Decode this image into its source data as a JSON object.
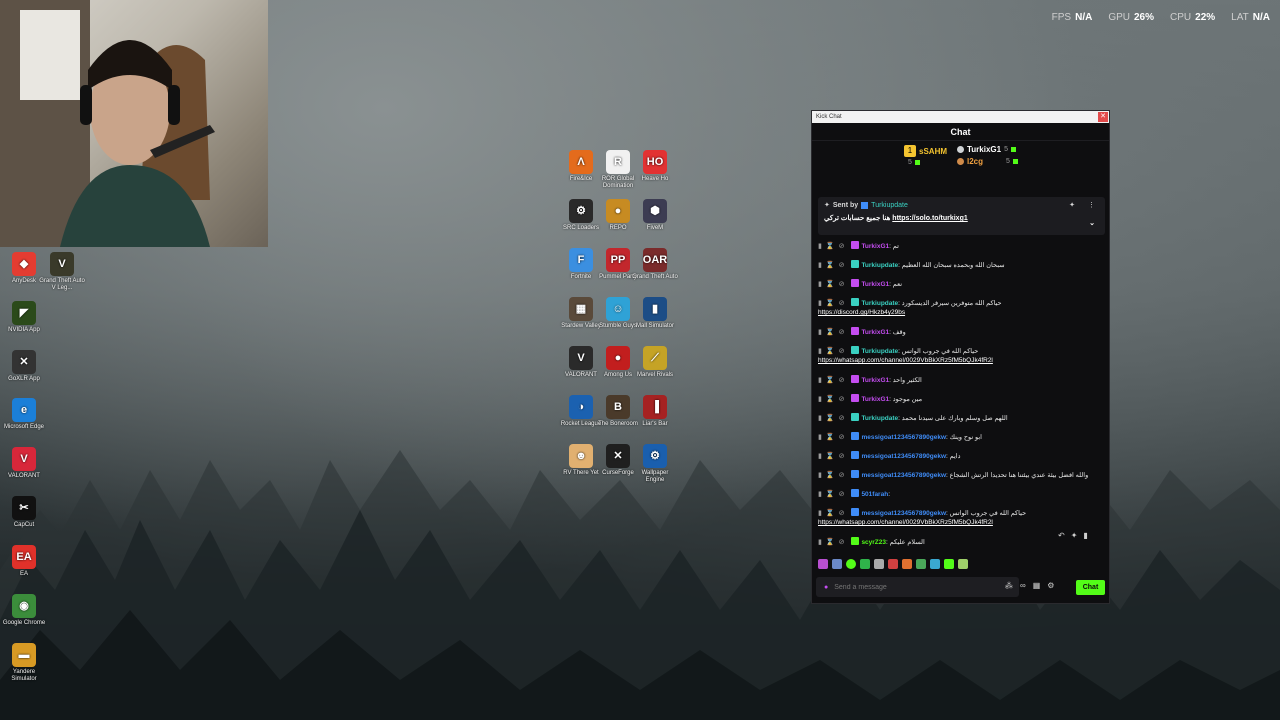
{
  "hud": {
    "fps_label": "FPS",
    "fps_value": "N/A",
    "gpu_label": "GPU",
    "gpu_value": "26%",
    "cpu_label": "CPU",
    "cpu_value": "22%",
    "lat_label": "LAT",
    "lat_value": "N/A"
  },
  "left_icons": [
    {
      "name": "AnyDesk",
      "color": "#e43c31",
      "glyph": "◆"
    },
    {
      "name": "Grand Theft Auto V Leg...",
      "color": "#3a3a2a",
      "glyph": "V"
    },
    {
      "name": "NVIDIA App",
      "color": "#2b4a1a",
      "glyph": "◤"
    },
    {
      "name": "GoXLR App",
      "color": "#333333",
      "glyph": "✕"
    },
    {
      "name": "Microsoft Edge",
      "color": "#1b7fd8",
      "glyph": "e"
    },
    {
      "name": "VALORANT",
      "color": "#d8273a",
      "glyph": "V"
    },
    {
      "name": "CapCut",
      "color": "#111111",
      "glyph": "✂"
    },
    {
      "name": "EA",
      "color": "#e0312a",
      "glyph": "EA"
    },
    {
      "name": "Google Chrome",
      "color": "#3b8d3b",
      "glyph": "◉"
    },
    {
      "name": "Yandere Simulator",
      "color": "#d89a24",
      "glyph": "▬"
    }
  ],
  "grid_icons": [
    {
      "name": "Fire&Ice",
      "color": "#e46b1c",
      "glyph": "Λ"
    },
    {
      "name": "ROR Global Domination",
      "color": "#f1f1f1",
      "glyph": "R"
    },
    {
      "name": "Heave Ho",
      "color": "#e23232",
      "glyph": "HO"
    },
    {
      "name": "SRC Loaders",
      "color": "#2a2a2a",
      "glyph": "⚙"
    },
    {
      "name": "REPO",
      "color": "#c78b22",
      "glyph": "●"
    },
    {
      "name": "FiveM",
      "color": "#3c3c52",
      "glyph": "⬢"
    },
    {
      "name": "Fortnite",
      "color": "#3b8fe0",
      "glyph": "F"
    },
    {
      "name": "Pummel Party",
      "color": "#c2272d",
      "glyph": "PP"
    },
    {
      "name": "Grand Theft Auto",
      "color": "#7a2b2b",
      "glyph": "OAR"
    },
    {
      "name": "Stardew Valley",
      "color": "#5a4a3a",
      "glyph": "▦"
    },
    {
      "name": "Stumble Guys",
      "color": "#2fa2d6",
      "glyph": "☺"
    },
    {
      "name": "Mall Simulator",
      "color": "#1c4d86",
      "glyph": "▮"
    },
    {
      "name": "VALORANT",
      "color": "#2a2a2a",
      "glyph": "V"
    },
    {
      "name": "Among Us",
      "color": "#c21e1e",
      "glyph": "●"
    },
    {
      "name": "Marvel Rivals",
      "color": "#c5a326",
      "glyph": "⟋"
    },
    {
      "name": "Rocket League",
      "color": "#1b61b0",
      "glyph": "◑"
    },
    {
      "name": "The Boneroom",
      "color": "#4a3a2a",
      "glyph": "B"
    },
    {
      "name": "Liar's Bar",
      "color": "#a52222",
      "glyph": "▐"
    },
    {
      "name": "RV There Yet",
      "color": "#e1b070",
      "glyph": "☻"
    },
    {
      "name": "CurseForge",
      "color": "#1f1f1f",
      "glyph": "✕"
    },
    {
      "name": "Wallpaper Engine",
      "color": "#1a5fae",
      "glyph": "⚙"
    }
  ],
  "chat": {
    "window_title": "Kick Chat",
    "header": "Chat",
    "leaderboard": {
      "first": {
        "name": "sSAHM",
        "count": "5"
      },
      "second": {
        "name": "TurkixG1",
        "count": "5"
      },
      "third": {
        "name": "l2cg",
        "count": "5"
      }
    },
    "pinned": {
      "sent_by_label": "Sent by",
      "user": "Turkiupdate",
      "text": "هنا جميع حسابات تركي",
      "link": "https://solo.to/turkixg1"
    },
    "colors": {
      "accent": "#53fc18",
      "purple": "#c44df0",
      "blue": "#3f8cf7",
      "teal": "#3ad1c2"
    },
    "messages": [
      {
        "user": "TurkixG1",
        "color": "#c44df0",
        "text": "تم",
        "link": ""
      },
      {
        "user": "Turkiupdate",
        "color": "#3ad1c2",
        "text": "سبحان الله وبحمده سبحان الله العظيم",
        "link": ""
      },
      {
        "user": "TurkixG1",
        "color": "#c44df0",
        "text": "نعم",
        "link": ""
      },
      {
        "user": "Turkiupdate",
        "color": "#3ad1c2",
        "text": "حياكم الله متوفرين سيرفر الديسكورد",
        "link": "https://discord.gg/Hkzb4y29bs"
      },
      {
        "user": "TurkixG1",
        "color": "#c44df0",
        "text": "وقف",
        "link": ""
      },
      {
        "user": "Turkiupdate",
        "color": "#3ad1c2",
        "text": "حياكم الله في جروب الواتس",
        "link": "https://whatsapp.com/channel/0029VbBkXRz5fM5bQJk4fR2l"
      },
      {
        "user": "TurkixG1",
        "color": "#c44df0",
        "text": "الكثير واحد",
        "link": ""
      },
      {
        "user": "TurkixG1",
        "color": "#c44df0",
        "text": "مين موجود",
        "link": ""
      },
      {
        "user": "Turkiupdate",
        "color": "#3ad1c2",
        "text": "اللهم صل وسلم وبارك على سيدنا محمد",
        "link": ""
      },
      {
        "user": "messigoat1234567890gekw",
        "color": "#3f8cf7",
        "text": "ابو نوح وينك",
        "link": ""
      },
      {
        "user": "messigoat1234567890gekw",
        "color": "#3f8cf7",
        "text": "دايم",
        "link": ""
      },
      {
        "user": "messigoat1234567890gekw",
        "color": "#3f8cf7",
        "text": "والله افضل بيئة عندي بيئتنا هنا تحديدا الرتش الشجاع",
        "link": ""
      },
      {
        "user": "501farah",
        "color": "#3f8cf7",
        "text": "",
        "link": ""
      },
      {
        "user": "messigoat1234567890gekw",
        "color": "#3f8cf7",
        "text": "حياكم الله في جروب الواتس",
        "link": "https://whatsapp.com/channel/0029VbBkXRz5fM5bQJk4fR2l"
      },
      {
        "user": "scyrZ23",
        "color": "#53fc18",
        "text": "السلام عليكم",
        "link": ""
      }
    ],
    "input_placeholder": "Send a message",
    "chat_button": "Chat"
  }
}
